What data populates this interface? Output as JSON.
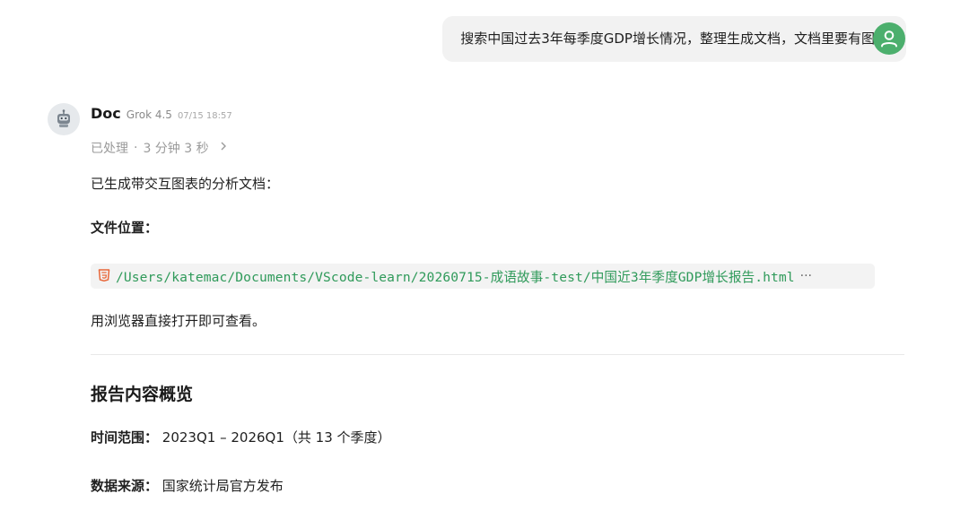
{
  "user": {
    "message": "搜索中国过去3年每季度GDP增长情况，整理生成文档，文档里要有图表"
  },
  "bot": {
    "name": "Doc",
    "model": "Grok 4.5",
    "time": "07/15 18:57",
    "status": "已处理",
    "duration": "3 分钟 3 秒",
    "intro": "已生成带交互图表的分析文档：",
    "file_label": "文件位置：",
    "file_path": "/Users/katemac/Documents/VScode-learn/20260715-成语故事-test/中国近3年季度GDP增长报告.html",
    "file_more": "···",
    "open_hint": "用浏览器直接打开即可查看。",
    "section_title": "报告内容概览",
    "time_range_label": "时间范围：",
    "time_range_value": "2023Q1 – 2026Q1（共 13 个季度）",
    "source_label": "数据来源：",
    "source_value": "国家统计局官方发布"
  },
  "colors": {
    "user_avatar": "#4caf6d",
    "code_text": "#2f9a5a",
    "html_icon": "#e8673a"
  },
  "icons": {
    "user_avatar": "user-icon",
    "bot_avatar": "robot-icon",
    "file": "html5-icon",
    "expand": "chevron-right-icon"
  }
}
